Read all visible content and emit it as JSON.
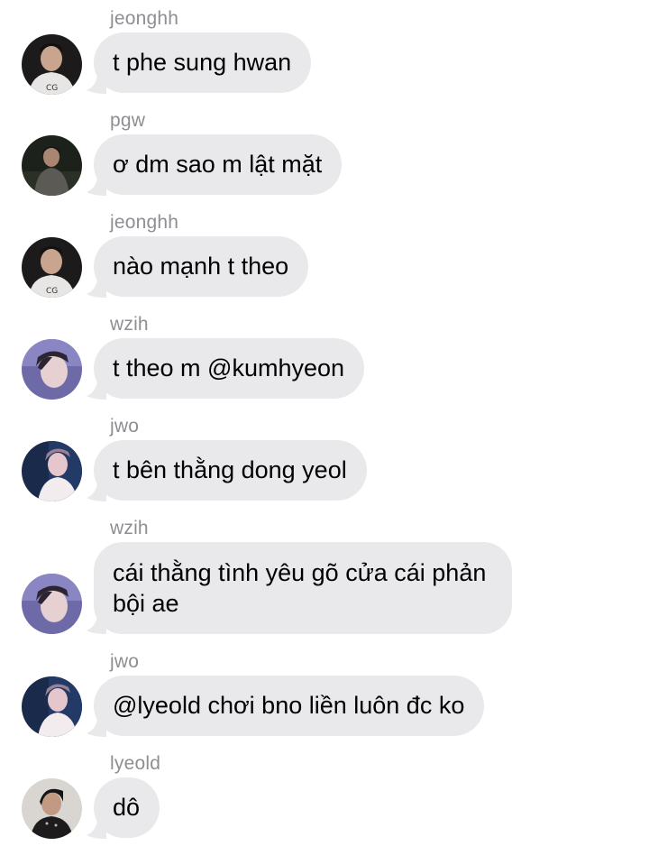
{
  "messages": [
    {
      "sender": "jeonghh",
      "text": "t phe sung hwan",
      "avatar": "avatar-jeonghh"
    },
    {
      "sender": "pgw",
      "text": "ơ dm sao m lật mặt",
      "avatar": "avatar-pgw"
    },
    {
      "sender": "jeonghh",
      "text": "nào mạnh t theo",
      "avatar": "avatar-jeonghh"
    },
    {
      "sender": "wzih",
      "text": "t theo m @kumhyeon",
      "avatar": "avatar-wzih"
    },
    {
      "sender": "jwo",
      "text": "t bên thằng dong yeol",
      "avatar": "avatar-jwo"
    },
    {
      "sender": "wzih",
      "text": "cái thằng tình yêu gõ cửa cái phản bội ae",
      "avatar": "avatar-wzih"
    },
    {
      "sender": "jwo",
      "text": "@lyeold chơi bno liền luôn đc ko",
      "avatar": "avatar-jwo"
    },
    {
      "sender": "lyeold",
      "text": "dô",
      "avatar": "avatar-lyeold"
    }
  ],
  "colors": {
    "bubble": "#e9e9eb",
    "sender": "#8e8e93",
    "text": "#000000",
    "background": "#ffffff"
  }
}
